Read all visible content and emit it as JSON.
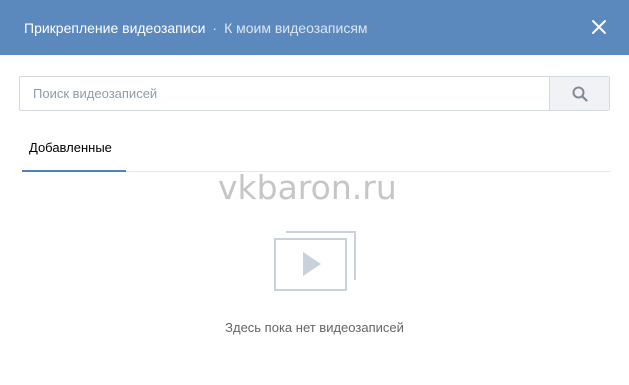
{
  "header": {
    "title": "Прикрепление видеозаписи",
    "separator": "·",
    "link_label": "К моим видеозаписям",
    "close_icon": "close-icon",
    "background_color": "#5b88bd"
  },
  "search": {
    "placeholder": "Поиск видеозаписей",
    "value": "",
    "button_icon": "search-icon"
  },
  "tabs": [
    {
      "label": "Добавленные",
      "active": true
    }
  ],
  "watermark": "vkbaron.ru",
  "empty_state": {
    "icon": "video-stack-icon",
    "message": "Здесь пока нет видеозаписей"
  }
}
